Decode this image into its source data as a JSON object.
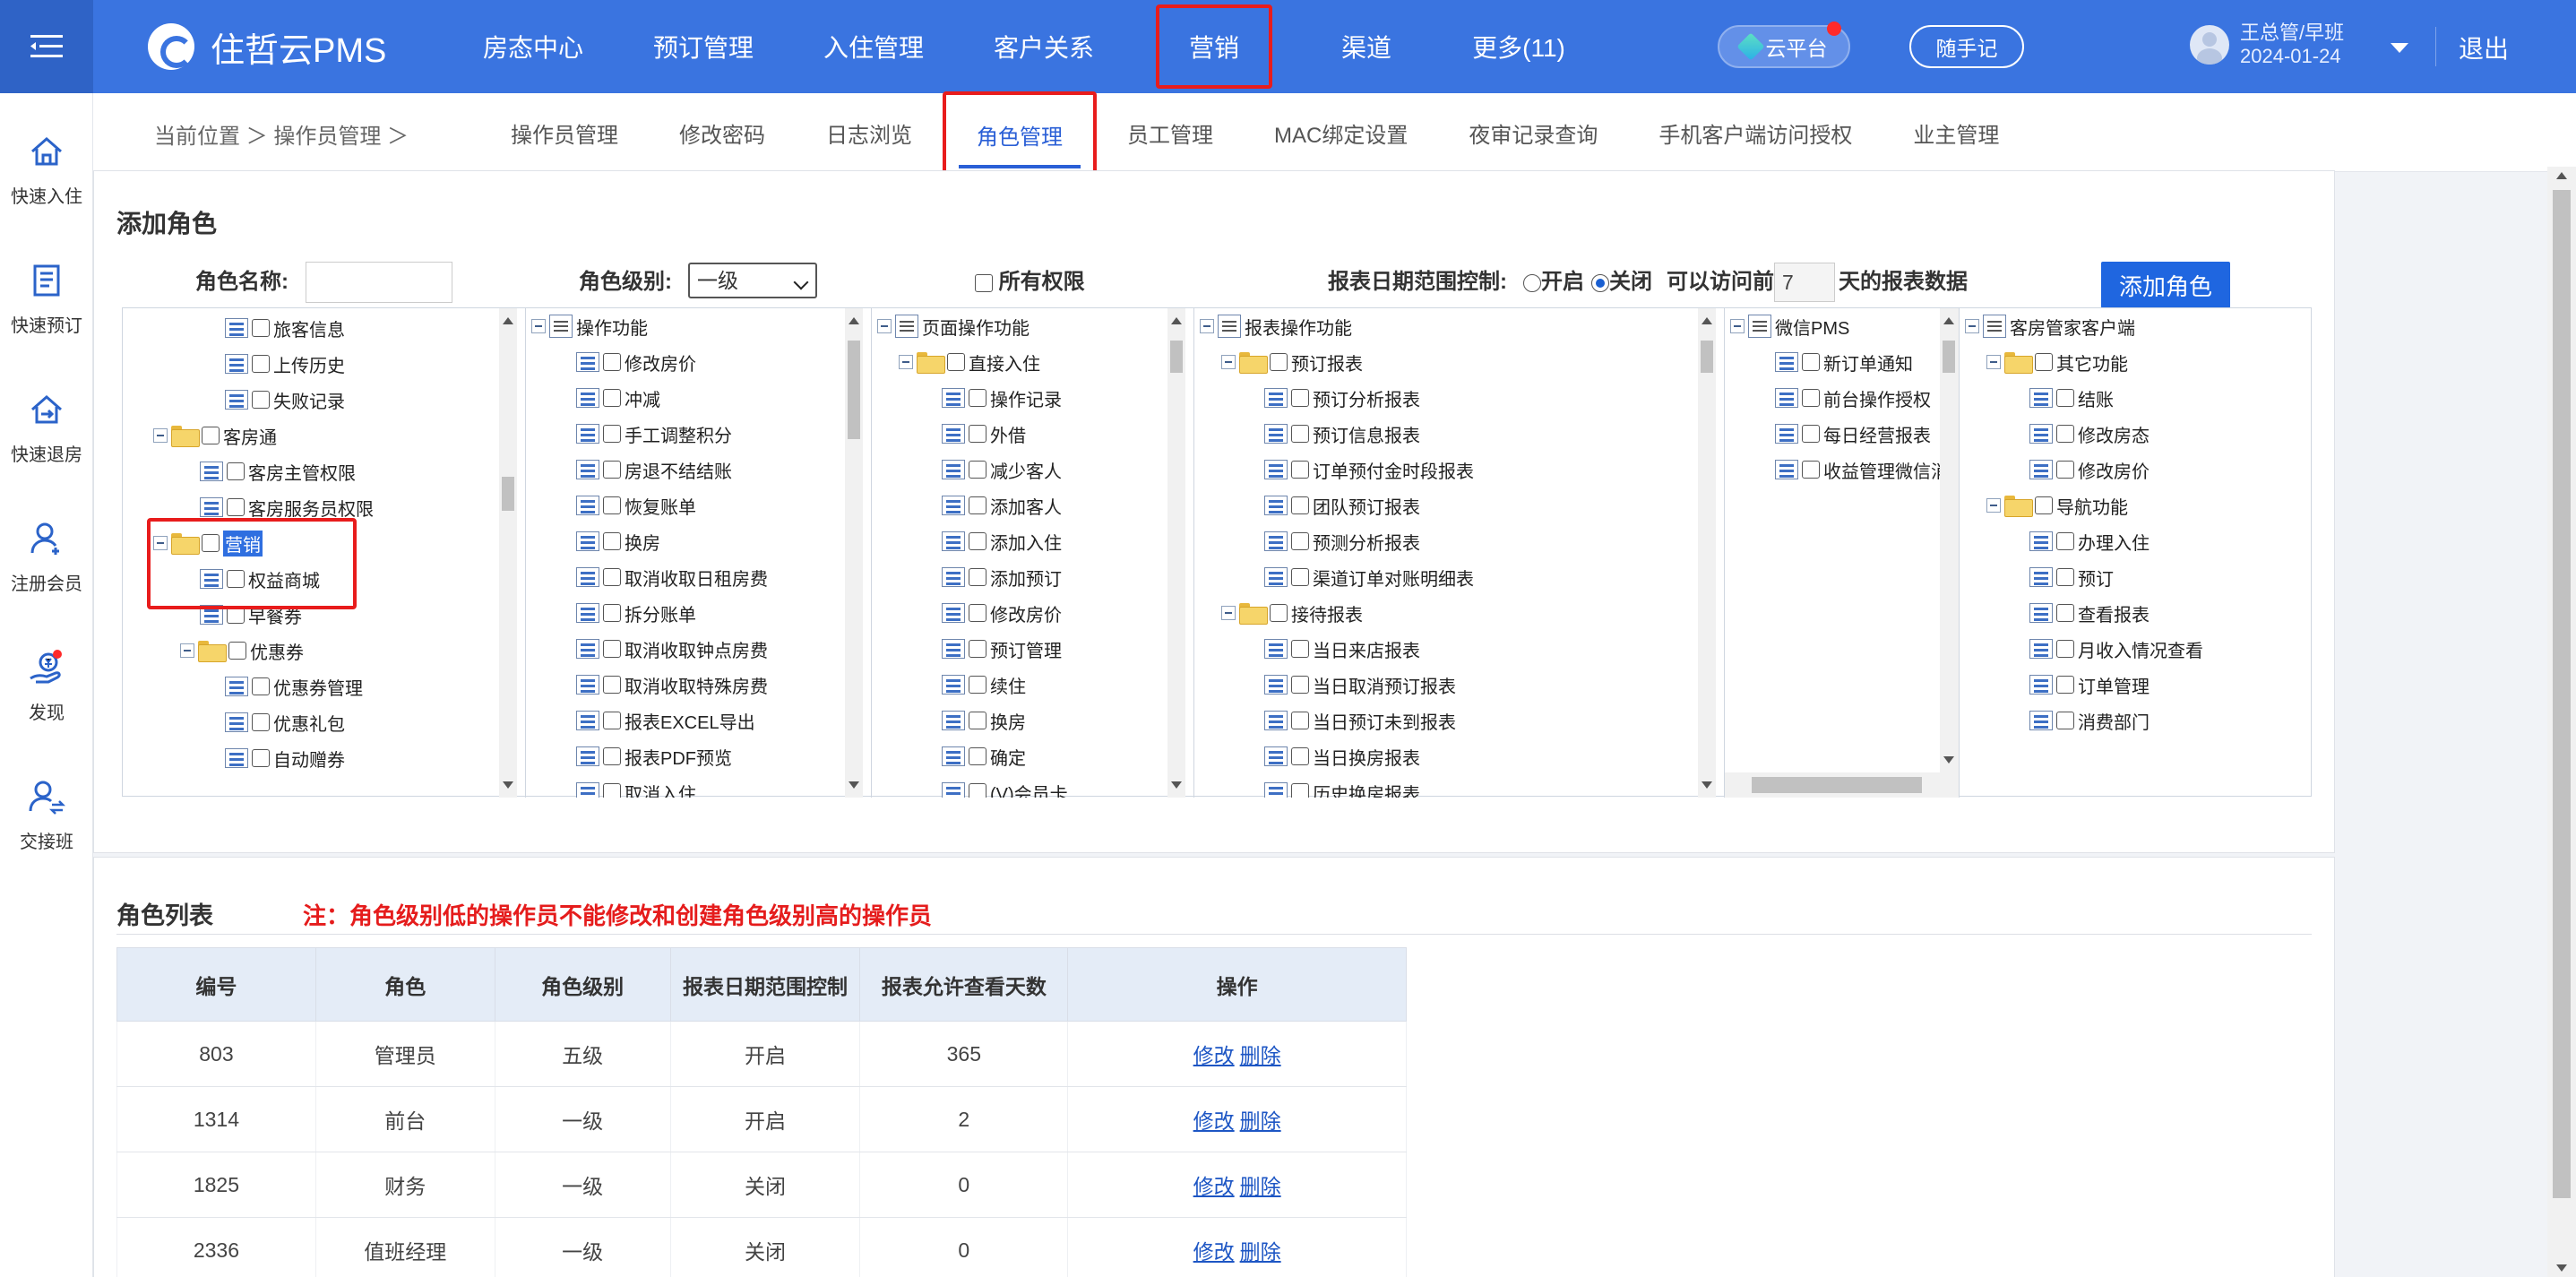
{
  "app": {
    "title": "住哲云PMS"
  },
  "nav": {
    "items": [
      {
        "label": "房态中心"
      },
      {
        "label": "预订管理"
      },
      {
        "label": "入住管理"
      },
      {
        "label": "客户关系"
      },
      {
        "label": "营销"
      },
      {
        "label": "渠道"
      },
      {
        "label": "更多(11)"
      }
    ],
    "highlighted": "营销"
  },
  "header": {
    "cloud_platform": "云平台",
    "notes": "随手记",
    "user_name": "王总管/早班",
    "user_date": "2024-01-24",
    "logout": "退出"
  },
  "sidebar": {
    "items": [
      {
        "label": "快速入住",
        "icon": "home-icon"
      },
      {
        "label": "快速预订",
        "icon": "book-icon"
      },
      {
        "label": "快速退房",
        "icon": "checkout-icon"
      },
      {
        "label": "注册会员",
        "icon": "user-add-icon"
      },
      {
        "label": "发现",
        "icon": "discover-icon"
      },
      {
        "label": "交接班",
        "icon": "handover-icon"
      }
    ]
  },
  "breadcrumb": {
    "text": "当前位置 ＞ 操作员管理 ＞"
  },
  "tabs": [
    {
      "label": "操作员管理"
    },
    {
      "label": "修改密码"
    },
    {
      "label": "日志浏览"
    },
    {
      "label": "角色管理"
    },
    {
      "label": "员工管理"
    },
    {
      "label": "MAC绑定设置"
    },
    {
      "label": "夜审记录查询"
    },
    {
      "label": "手机客户端访问授权"
    },
    {
      "label": "业主管理"
    }
  ],
  "active_tab": "角色管理",
  "add_role": {
    "title": "添加角色",
    "name_label": "角色名称:",
    "name_value": "",
    "level_label": "角色级别:",
    "level_value": "一级",
    "all_permissions": "所有权限",
    "date_control_label": "报表日期范围控制:",
    "radio_on": "开启",
    "radio_off": "关闭",
    "date_control_selected": "关闭",
    "access_prefix": "可以访问前",
    "access_days": "7",
    "access_suffix": "天的报表数据",
    "add_button": "添加角色"
  },
  "tree": {
    "col1": [
      "旅客信息",
      "上传历史",
      "失败记录",
      "客房通",
      "客房主管权限",
      "客房服务员权限",
      "营销",
      "权益商城",
      "早餐券",
      "优惠券",
      "优惠券管理",
      "优惠礼包",
      "自动赠券"
    ],
    "col2": [
      "操作功能",
      "修改房价",
      "冲减",
      "手工调整积分",
      "房退不结结账",
      "恢复账单",
      "换房",
      "取消收取日租房费",
      "拆分账单",
      "取消收取钟点房费",
      "取消收取特殊房费",
      "报表EXCEL导出",
      "报表PDF预览",
      "取消入住"
    ],
    "col3": [
      "页面操作功能",
      "直接入住",
      "操作记录",
      "外借",
      "减少客人",
      "添加客人",
      "添加入住",
      "添加预订",
      "修改房价",
      "预订管理",
      "续住",
      "换房",
      "确定",
      "(V)会员卡"
    ],
    "col4": [
      "报表操作功能",
      "预订报表",
      "预订分析报表",
      "预订信息报表",
      "订单预付金时段报表",
      "团队预订报表",
      "预测分析报表",
      "渠道订单对账明细表",
      "接待报表",
      "当日来店报表",
      "当日取消预订报表",
      "当日预订未到报表",
      "当日换房报表",
      "历史换房报表"
    ],
    "col5": [
      "微信PMS",
      "新订单通知",
      "前台操作授权",
      "每日经营报表",
      "收益管理微信消息"
    ],
    "col6": [
      "客房管家客户端",
      "其它功能",
      "结账",
      "修改房态",
      "修改房价",
      "导航功能",
      "办理入住",
      "预订",
      "查看报表",
      "月收入情况查看",
      "订单管理",
      "消费部门"
    ]
  },
  "role_list": {
    "title": "角色列表",
    "note": "注：角色级别低的操作员不能修改和创建角色级别高的操作员",
    "headers": [
      "编号",
      "角色",
      "角色级别",
      "报表日期范围控制",
      "报表允许查看天数",
      "操作"
    ],
    "edit_label": "修改",
    "delete_label": "删除",
    "rows": [
      {
        "id": "803",
        "role": "管理员",
        "level": "五级",
        "control": "开启",
        "days": "365"
      },
      {
        "id": "1314",
        "role": "前台",
        "level": "一级",
        "control": "开启",
        "days": "2"
      },
      {
        "id": "1825",
        "role": "财务",
        "level": "一级",
        "control": "关闭",
        "days": "0"
      },
      {
        "id": "2336",
        "role": "值班经理",
        "level": "一级",
        "control": "关闭",
        "days": "0"
      }
    ]
  },
  "colors": {
    "brand": "#3a74e0",
    "highlight_box": "#e81c1c",
    "note_red": "#e51c1c",
    "link": "#1d56c4"
  }
}
